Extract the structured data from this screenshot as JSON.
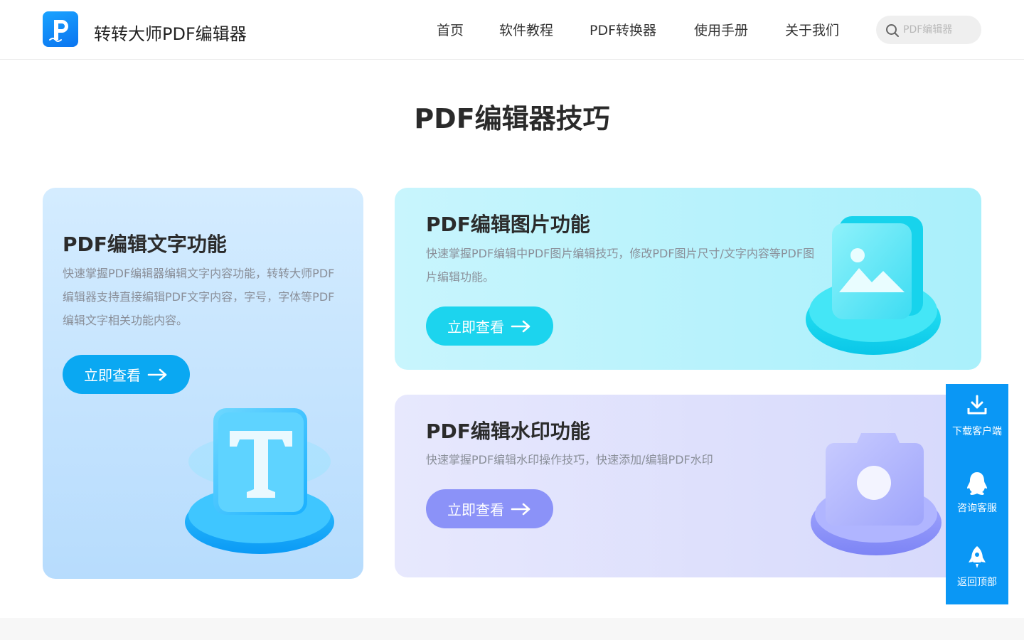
{
  "header": {
    "brand": "转转大师PDF编辑器",
    "nav": [
      "首页",
      "软件教程",
      "PDF转换器",
      "使用手册",
      "关于我们"
    ],
    "search_placeholder": "PDF编辑器"
  },
  "page_title": "PDF编辑器技巧",
  "cards": [
    {
      "title": "PDF编辑文字功能",
      "desc": "快速掌握PDF编辑器编辑文字内容功能，转转大师PDF编辑器支持直接编辑PDF文字内容，字号，字体等PDF编辑文字相关功能内容。",
      "button": "立即查看",
      "icon": "text-t-icon"
    },
    {
      "title": "PDF编辑图片功能",
      "desc": "快速掌握PDF编辑中PDF图片编辑技巧，修改PDF图片尺寸/文字内容等PDF图片编辑功能。",
      "button": "立即查看",
      "icon": "image-icon"
    },
    {
      "title": "PDF编辑水印功能",
      "desc": "快速掌握PDF编辑水印操作技巧，快速添加/编辑PDF水印",
      "button": "立即查看",
      "icon": "camera-icon"
    }
  ],
  "sidebar": [
    {
      "label": "下载客户端",
      "icon": "download-icon"
    },
    {
      "label": "咨询客服",
      "icon": "qq-penguin-icon"
    },
    {
      "label": "返回顶部",
      "icon": "rocket-icon"
    }
  ],
  "colors": {
    "primary": "#0a97f5",
    "text_card_btn": "#0aa8f2",
    "image_card_btn": "#1cd4ee",
    "mark_card_btn": "#8b92f8"
  }
}
